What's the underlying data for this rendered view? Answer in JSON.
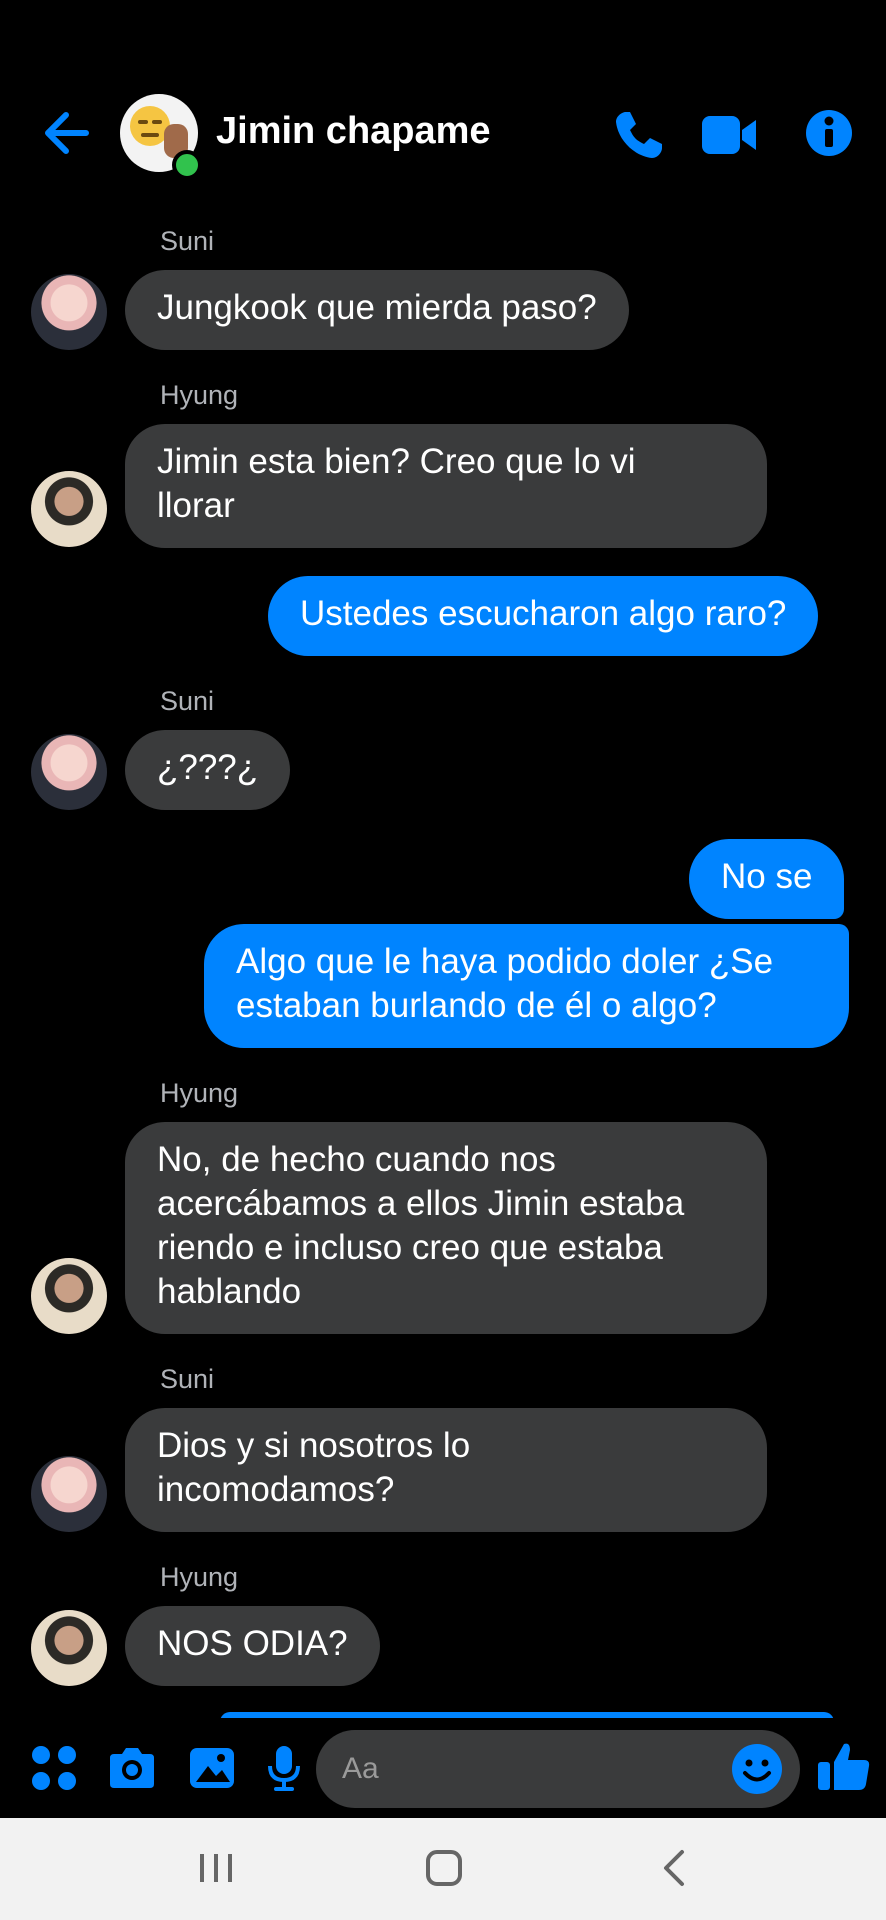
{
  "header": {
    "title": "Jimin chapame"
  },
  "messages": [
    {
      "sender": "Suni",
      "text": "Jungkook que mierda paso?"
    },
    {
      "sender": "Hyung",
      "text": "Jimin esta bien? Creo que lo vi\nllorar"
    },
    {
      "text": "Ustedes escucharon algo raro?"
    },
    {
      "sender": "Suni",
      "text": "¿???¿"
    },
    {
      "text": "No se"
    },
    {
      "text": "Algo que le haya podido doler ¿Se\nestaban burlando de él o algo?"
    },
    {
      "sender": "Hyung",
      "text": "No, de hecho cuando nos\nacercábamos a ellos Jimin estaba\nriendo e incluso creo que estaba\nhablando"
    },
    {
      "sender": "Suni",
      "text": "Dios y si nosotros lo\nincomodamos?"
    },
    {
      "sender": "Hyung",
      "text": "NOS ODIA?"
    }
  ],
  "composer": {
    "placeholder": "Aa"
  },
  "colors": {
    "accent": "#0084ff",
    "incoming_bubble": "#3a3b3c",
    "background": "#000000",
    "online": "#31c24d"
  },
  "icons": {
    "back": "arrow-left-icon",
    "call": "phone-icon",
    "video": "video-camera-icon",
    "info": "info-icon",
    "apps": "apps-grid-icon",
    "camera": "camera-icon",
    "gallery": "image-icon",
    "mic": "microphone-icon",
    "emoji": "smiley-icon",
    "like": "thumbs-up-icon"
  }
}
